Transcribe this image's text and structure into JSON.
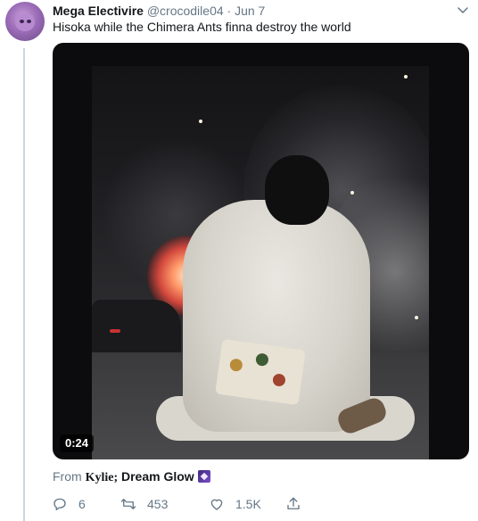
{
  "tweet": {
    "display_name": "Mega Electivire",
    "handle": "@crocodile04",
    "separator": "·",
    "date": "Jun 7",
    "text": "Hisoka while the Chimera Ants finna destroy the world"
  },
  "media": {
    "type": "video",
    "duration": "0:24"
  },
  "source": {
    "prefix": "From",
    "name_serif": "Kylie;",
    "name_rest": "Dream Glow"
  },
  "actions": {
    "reply_count": "6",
    "retweet_count": "453",
    "like_count": "1.5K"
  },
  "colors": {
    "text_primary": "#14171a",
    "text_secondary": "#657786",
    "thread_line": "#ccd6dd"
  },
  "icons": [
    "chevron-down-icon",
    "reply-icon",
    "retweet-icon",
    "like-icon",
    "share-icon",
    "sparkle-icon"
  ]
}
